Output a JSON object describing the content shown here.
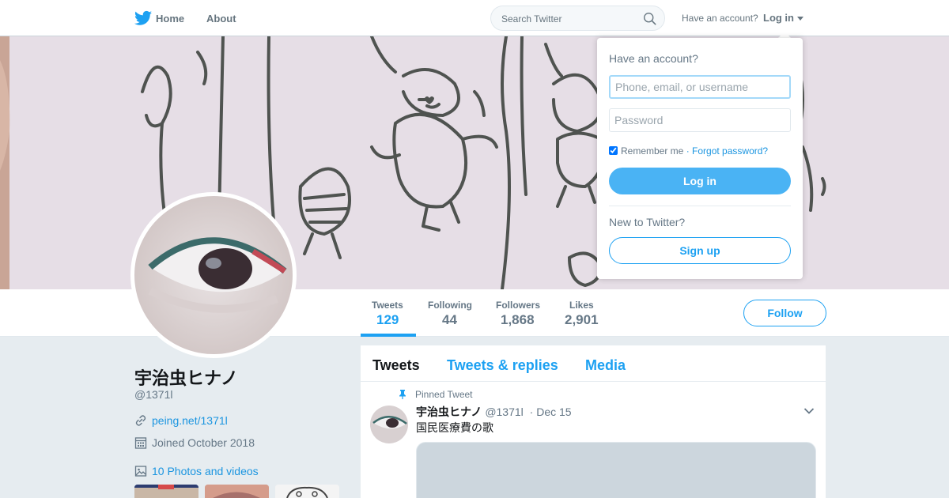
{
  "nav": {
    "home_label": "Home",
    "about_label": "About",
    "search_placeholder": "Search Twitter",
    "have_account": "Have an account?",
    "login_label": "Log in"
  },
  "profile": {
    "display_name": "宇治虫ヒナノ",
    "screen_name": "@1371l",
    "link": "peing.net/1371l",
    "joined": "Joined October 2018",
    "photos_label": "10 Photos and videos",
    "follow_label": "Follow"
  },
  "stats": [
    {
      "label": "Tweets",
      "value": "129"
    },
    {
      "label": "Following",
      "value": "44"
    },
    {
      "label": "Followers",
      "value": "1,868"
    },
    {
      "label": "Likes",
      "value": "2,901"
    }
  ],
  "timeline": {
    "tabs": [
      "Tweets",
      "Tweets & replies",
      "Media"
    ],
    "pinned_label": "Pinned Tweet",
    "tweet": {
      "name": "宇治虫ヒナノ",
      "handle": "@1371l",
      "date": "· Dec 15",
      "text": "国民医療費の歌"
    }
  },
  "login_dropdown": {
    "title": "Have an account?",
    "username_placeholder": "Phone, email, or username",
    "password_placeholder": "Password",
    "remember_label": "Remember me",
    "forgot_label": "· Forgot password?",
    "login_button": "Log in",
    "new_label": "New to Twitter?",
    "signup_button": "Sign up"
  },
  "colors": {
    "accent": "#1da1f2",
    "background": "#e6ecf0",
    "login_button": "#4ab3f4"
  }
}
